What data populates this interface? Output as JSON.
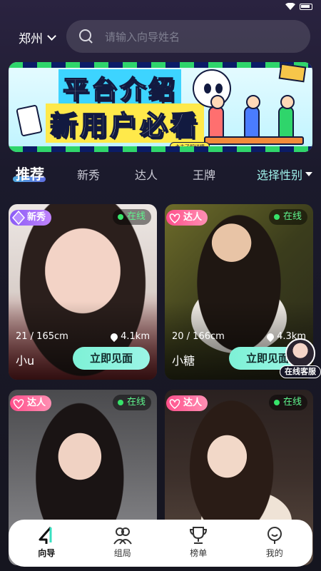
{
  "location": {
    "city": "郑州"
  },
  "search": {
    "placeholder": "请输入向导姓名"
  },
  "banner": {
    "line1": "平台介绍",
    "line2": "新用户必看",
    "cta": "点击了解详情"
  },
  "tabs": [
    {
      "label": "推荐",
      "active": true
    },
    {
      "label": "新秀",
      "active": false
    },
    {
      "label": "达人",
      "active": false
    },
    {
      "label": "王牌",
      "active": false
    }
  ],
  "gender_filter": {
    "label": "选择性别"
  },
  "cards": [
    {
      "badge": "新秀",
      "status": "在线",
      "stats": "21 / 165cm",
      "distance": "4.1km",
      "name": "小u",
      "action": "立即见面"
    },
    {
      "badge": "达人",
      "status": "在线",
      "stats": "20 / 166cm",
      "distance": "4.3km",
      "name": "小糖",
      "action": "立即见面"
    },
    {
      "badge": "达人",
      "status": "在线"
    },
    {
      "badge": "达人",
      "status": "在线"
    }
  ],
  "customer_service": {
    "label": "在线客服"
  },
  "nav": [
    {
      "label": "向导",
      "icon": "guide-icon",
      "active": true
    },
    {
      "label": "组局",
      "icon": "group-icon",
      "active": false
    },
    {
      "label": "榜单",
      "icon": "trophy-icon",
      "active": false
    },
    {
      "label": "我的",
      "icon": "profile-icon",
      "active": false
    }
  ],
  "colors": {
    "accent": "#7ef1d6",
    "online": "#37e36a",
    "badge_new": "#8b5cf6",
    "badge_pro": "#ff4f8b"
  }
}
